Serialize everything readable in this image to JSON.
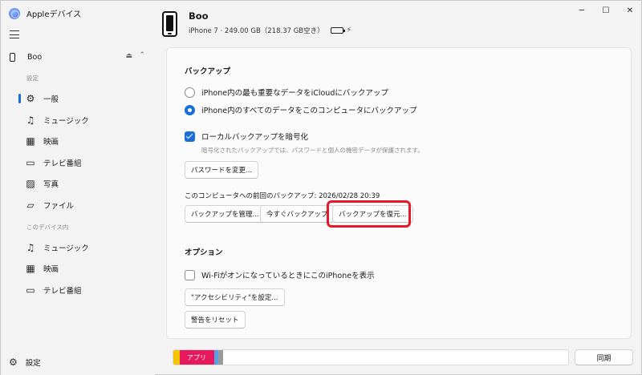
{
  "app": {
    "title": "Appleデバイス"
  },
  "window_controls": {
    "minimize": "─",
    "maximize": "☐",
    "close": "✕"
  },
  "sidebar": {
    "device": {
      "name": "Boo",
      "eject_glyph": "⏏",
      "collapse_glyph": "⌃"
    },
    "settings_section": "設定",
    "settings_items": [
      {
        "label": "一般",
        "icon": "gear-icon",
        "glyph": "⚙",
        "active": true
      },
      {
        "label": "ミュージック",
        "icon": "music-note-icon",
        "glyph": "♫"
      },
      {
        "label": "映画",
        "icon": "film-icon",
        "glyph": "▦"
      },
      {
        "label": "テレビ番組",
        "icon": "tv-icon",
        "glyph": "▭"
      },
      {
        "label": "写真",
        "icon": "photo-icon",
        "glyph": "▨"
      },
      {
        "label": "ファイル",
        "icon": "folder-icon",
        "glyph": "▱"
      }
    ],
    "device_section": "このデバイス内",
    "device_items": [
      {
        "label": "ミュージック",
        "icon": "music-note-icon",
        "glyph": "♫"
      },
      {
        "label": "映画",
        "icon": "film-icon",
        "glyph": "▦"
      },
      {
        "label": "テレビ番組",
        "icon": "tv-icon",
        "glyph": "▭"
      }
    ],
    "footer": {
      "label": "設定",
      "icon": "gear-icon",
      "glyph": "⚙"
    }
  },
  "header": {
    "device_name": "Boo",
    "device_info": "iPhone 7 · 249.00 GB（218.37 GB空き）",
    "battery_level": 0.75,
    "charging_glyph": "⚡"
  },
  "backup": {
    "title": "バックアップ",
    "options": [
      {
        "label": "iPhone内の最も重要なデータをiCloudにバックアップ",
        "selected": false
      },
      {
        "label": "iPhone内のすべてのデータをこのコンピュータにバックアップ",
        "selected": true
      }
    ],
    "encrypt_label": "ローカルバックアップを暗号化",
    "encrypt_checked": true,
    "encrypt_note": "暗号化されたバックアップでは、パスワードと個人の機密データが保護されます。",
    "change_password_button": "パスワードを変更...",
    "last_backup": "このコンピュータへの前回のバックアップ: 2026/02/28 20:39",
    "manage_button": "バックアップを管理...",
    "backup_now_button": "今すぐバックアップ",
    "restore_button": "バックアップを復元..."
  },
  "options": {
    "title": "オプション",
    "wifi_label": "Wi-Fiがオンになっているときにこのi​Phoneを表示",
    "wifi_checked": false,
    "accessibility_button": "\"アクセシビリティ\"を設定...",
    "reset_warnings_button": "警告をリセット"
  },
  "storage_bar": {
    "apps_label": "アプリ",
    "colors": {
      "yellow": "#f5c400",
      "apps": "#e8185f",
      "blue": "#5aa0e6",
      "gray": "#9a9a9a",
      "free": "#ffffff"
    }
  },
  "sync_button": "同期",
  "accent": "#1a6fd6",
  "highlight_color": "#e6192b"
}
